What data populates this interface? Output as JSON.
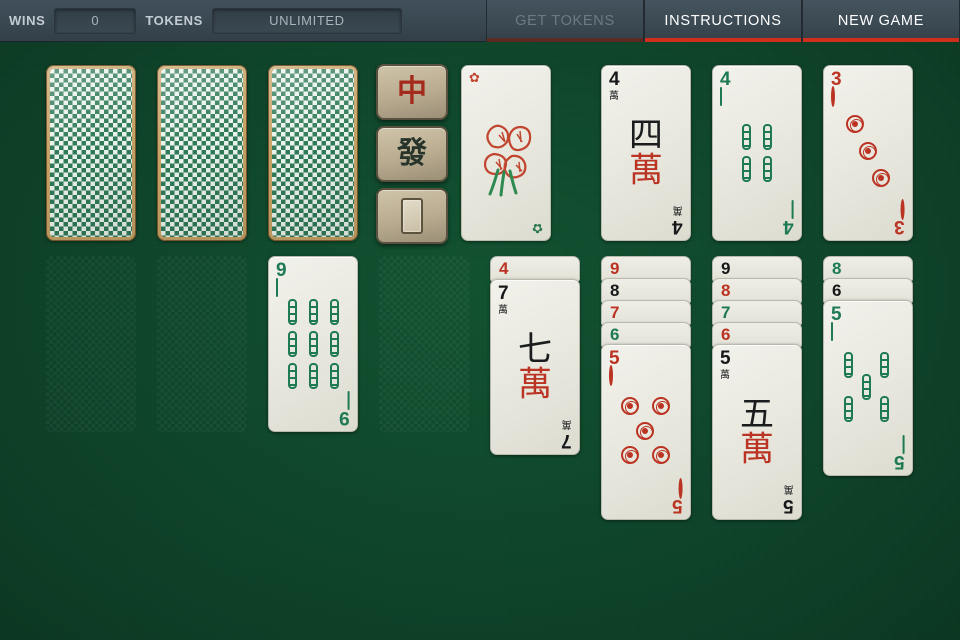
{
  "topbar": {
    "wins_label": "WINS",
    "wins_value": "0",
    "tokens_label": "TOKENS",
    "tokens_value": "UNLIMITED",
    "buttons": [
      {
        "label": "GET TOKENS",
        "name": "get-tokens-button",
        "disabled": true
      },
      {
        "label": "INSTRUCTIONS",
        "name": "instructions-button",
        "disabled": false
      },
      {
        "label": "NEW GAME",
        "name": "new-game-button",
        "disabled": false
      }
    ],
    "accent_color": "#cf2f1d",
    "bar_color": "#3a4851"
  },
  "board": {
    "felt_color": "#0d4a2a",
    "stock_label": "face-down-stock",
    "foundations": [
      {
        "name": "red-dragon-slot",
        "glyph": "中",
        "color": "red"
      },
      {
        "name": "green-dragon-slot",
        "glyph": "發",
        "color": "green"
      },
      {
        "name": "white-dragon-slot",
        "glyph": "",
        "color": "white"
      }
    ],
    "suit_glyphs": {
      "characters": "萬",
      "characters_big_numbers": {
        "4": "四",
        "5": "五",
        "7": "七"
      },
      "flower": "✿"
    },
    "top_row": [
      {
        "type": "back",
        "name": "card-back-1"
      },
      {
        "type": "back",
        "name": "card-back-2"
      },
      {
        "type": "back",
        "name": "card-back-3"
      },
      {
        "type": "flower",
        "name": "flower-card",
        "label": "Flower"
      },
      {
        "type": "characters",
        "rank": "4",
        "color": "black",
        "name": "card-4-characters"
      },
      {
        "type": "bamboo",
        "rank": "4",
        "color": "green",
        "name": "card-4-bamboo"
      },
      {
        "type": "circles",
        "rank": "3",
        "color": "red",
        "name": "card-3-circles"
      }
    ],
    "tableau": [
      {
        "name": "tableau-column-1",
        "empty": true,
        "stack": []
      },
      {
        "name": "tableau-column-2",
        "empty": true,
        "stack": []
      },
      {
        "name": "tableau-column-3",
        "empty": false,
        "stack": [],
        "bottom": {
          "type": "bamboo",
          "rank": "9",
          "color": "green",
          "name": "card-9-bamboo"
        }
      },
      {
        "name": "tableau-column-4",
        "empty": true,
        "stack": []
      },
      {
        "name": "tableau-column-5",
        "empty": false,
        "stack": [
          {
            "rank": "4",
            "color": "red"
          }
        ],
        "bottom": {
          "type": "characters",
          "rank": "7",
          "color": "black",
          "name": "card-7-characters"
        }
      },
      {
        "name": "tableau-column-6",
        "empty": false,
        "stack": [
          {
            "rank": "9",
            "color": "red"
          },
          {
            "rank": "8",
            "color": "black"
          },
          {
            "rank": "7",
            "color": "red"
          },
          {
            "rank": "6",
            "color": "green"
          }
        ],
        "bottom": {
          "type": "circles",
          "rank": "5",
          "color": "red",
          "name": "card-5-circles"
        }
      },
      {
        "name": "tableau-column-7",
        "empty": false,
        "stack": [
          {
            "rank": "9",
            "color": "black"
          },
          {
            "rank": "8",
            "color": "red"
          },
          {
            "rank": "7",
            "color": "green"
          },
          {
            "rank": "6",
            "color": "red"
          }
        ],
        "bottom": {
          "type": "characters",
          "rank": "5",
          "color": "black",
          "name": "card-5-characters"
        }
      },
      {
        "name": "tableau-column-8",
        "empty": false,
        "stack": [
          {
            "rank": "8",
            "color": "green"
          },
          {
            "rank": "6",
            "color": "black"
          }
        ],
        "bottom": {
          "type": "bamboo",
          "rank": "5",
          "color": "green",
          "name": "card-5-bamboo"
        }
      }
    ]
  }
}
